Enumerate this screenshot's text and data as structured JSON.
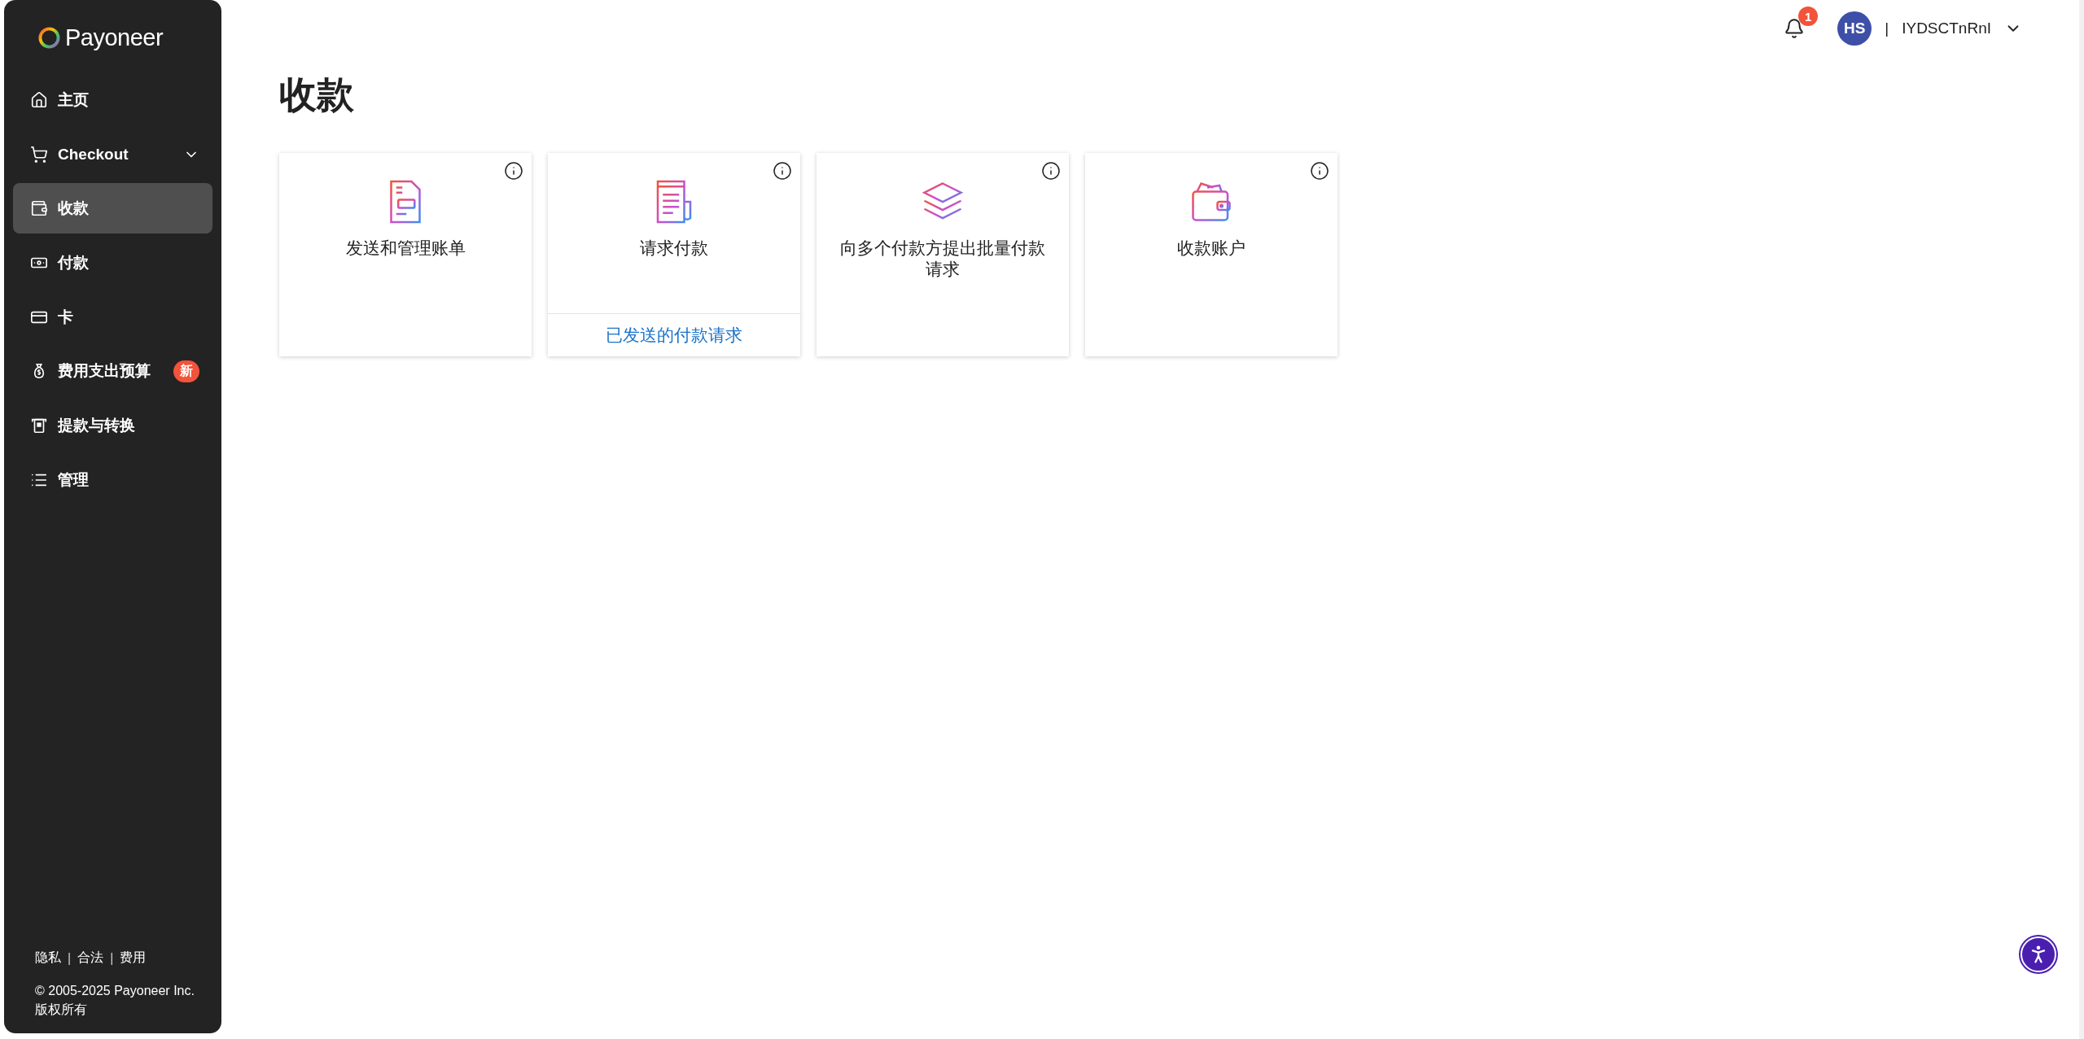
{
  "brand": {
    "name": "Payoneer"
  },
  "sidebar": {
    "items": [
      {
        "label": "主页",
        "selected": false
      },
      {
        "label": "Checkout",
        "selected": false,
        "expanded": false
      },
      {
        "label": "收款",
        "selected": true
      },
      {
        "label": "付款",
        "selected": false
      },
      {
        "label": "卡",
        "selected": false
      },
      {
        "label": "费用支出预算",
        "selected": false,
        "badge": "新"
      },
      {
        "label": "提款与转换",
        "selected": false
      },
      {
        "label": "管理",
        "selected": false
      }
    ],
    "footer_links": [
      {
        "kind": "link",
        "text": "隐私"
      },
      {
        "kind": "separator",
        "text": "|"
      },
      {
        "kind": "link",
        "text": "合法"
      },
      {
        "kind": "separator",
        "text": "|"
      },
      {
        "kind": "link",
        "text": "费用"
      }
    ],
    "copyright": [
      "© 2005-2025 Payoneer Inc.",
      "版权所有"
    ]
  },
  "header": {
    "notifications": "1",
    "avatar": "HS",
    "separator": "|",
    "username": "IYDSCTnRnI"
  },
  "page": {
    "title": "收款",
    "cards": [
      {
        "title": "发送和管理账单"
      },
      {
        "title": "请求付款",
        "link": "已发送的付款请求"
      },
      {
        "title": "向多个付款方提出批量付款请求"
      },
      {
        "title": "收款账户"
      }
    ]
  }
}
